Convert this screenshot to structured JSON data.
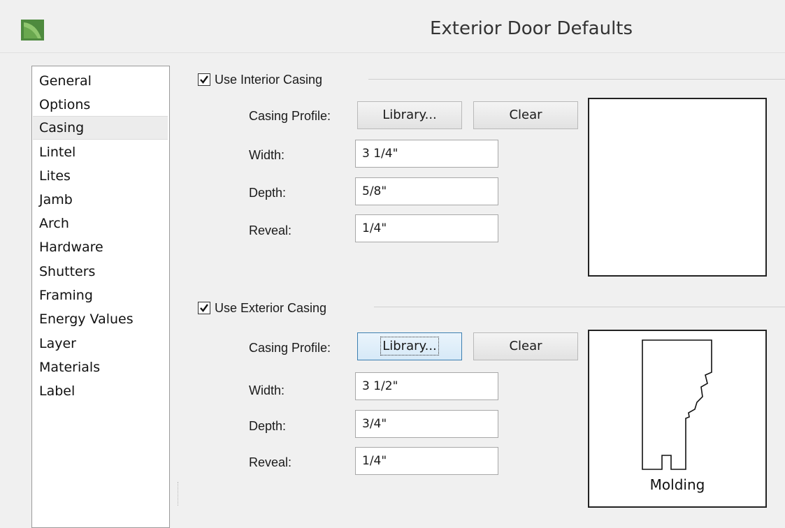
{
  "window": {
    "title": "Exterior Door Defaults"
  },
  "sidebar": {
    "items": [
      {
        "label": "General"
      },
      {
        "label": "Options"
      },
      {
        "label": "Casing",
        "selected": true
      },
      {
        "label": "Lintel"
      },
      {
        "label": "Lites"
      },
      {
        "label": "Jamb"
      },
      {
        "label": "Arch"
      },
      {
        "label": "Hardware"
      },
      {
        "label": "Shutters"
      },
      {
        "label": "Framing"
      },
      {
        "label": "Energy Values"
      },
      {
        "label": "Layer"
      },
      {
        "label": "Materials"
      },
      {
        "label": "Label"
      }
    ]
  },
  "interior": {
    "checkbox_label": "Use Interior Casing",
    "checked": true,
    "casing_profile_label": "Casing Profile:",
    "library_button": "Library...",
    "clear_button": "Clear",
    "width_label": "Width:",
    "width_value": "3 1/4\"",
    "depth_label": "Depth:",
    "depth_value": "5/8\"",
    "reveal_label": "Reveal:",
    "reveal_value": "1/4\""
  },
  "exterior": {
    "checkbox_label": "Use Exterior Casing",
    "checked": true,
    "casing_profile_label": "Casing Profile:",
    "library_button": "Library...",
    "clear_button": "Clear",
    "width_label": "Width:",
    "width_value": "3 1/2\"",
    "depth_label": "Depth:",
    "depth_value": "3/4\"",
    "reveal_label": "Reveal:",
    "reveal_value": "1/4\"",
    "preview_caption": "Molding"
  },
  "colors": {
    "app_icon": "#4e8a3e",
    "focus_border": "#3c7fb1"
  }
}
